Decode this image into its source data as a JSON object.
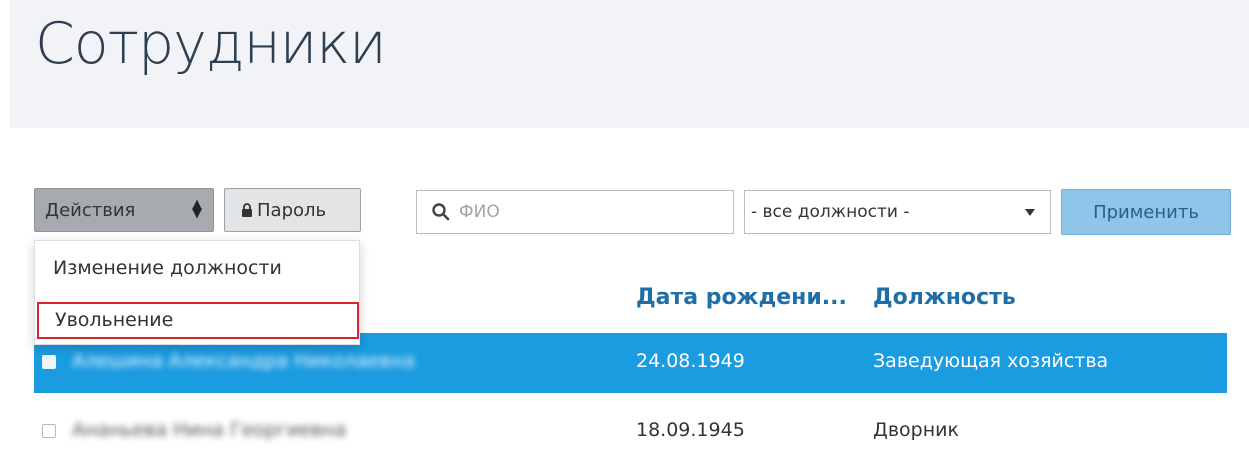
{
  "page": {
    "title": "Сотрудники"
  },
  "toolbar": {
    "actions_label": "Действия",
    "password_label": "Пароль",
    "search_placeholder": "ФИО",
    "position_filter_value": "- все должности -",
    "apply_label": "Применить"
  },
  "actions_menu": {
    "items": [
      "Изменение должности",
      "Увольнение"
    ]
  },
  "table": {
    "headers": {
      "birth_date": "Дата рождени...",
      "position": "Должность"
    },
    "rows": [
      {
        "name": "Алешина Александра Николаевна",
        "birth_date": "24.08.1949",
        "position": "Заведующая хозяйства",
        "selected": true
      },
      {
        "name": "Ананьева Нина Георгиевна",
        "birth_date": "18.09.1945",
        "position": "Дворник",
        "selected": false
      }
    ]
  },
  "colors": {
    "selected_row": "#1b9be0",
    "header_link": "#1f6ea8",
    "highlight_border": "#d9232e",
    "apply_button": "#8ec5e8"
  },
  "icons": [
    "chevron-updown-icon",
    "lock-icon",
    "search-icon",
    "dropdown-arrow-icon"
  ]
}
